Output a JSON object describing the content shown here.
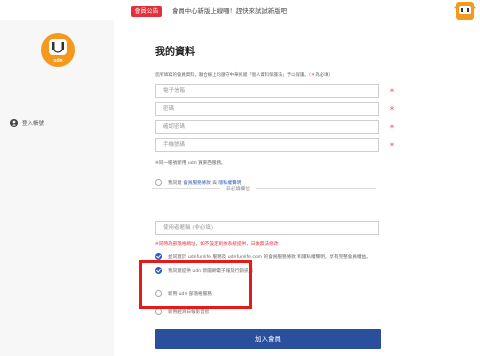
{
  "topbar": {
    "badge": "會員公告",
    "notice": "會員中心新版上線囉！趕快來試試新版吧",
    "colors": {
      "badge": "#e2313a"
    }
  },
  "sidebar": {
    "logo_icon": "udn-mascot-logo",
    "logo_text": "udn",
    "login_label": "登入帳號",
    "login_icon": "user-icon"
  },
  "main": {
    "title": "我的資料",
    "intro": "您所填寫的會員資料，聯合線上均遵守中華民國「個人資料保護法」予以保護。（",
    "intro_req": "＊",
    "intro_tail": "為必填）",
    "fields": [
      {
        "placeholder": "電子信箱"
      },
      {
        "placeholder": "密碼"
      },
      {
        "placeholder": "確認密碼"
      },
      {
        "placeholder": "手機號碼"
      }
    ],
    "required_mark": "＊",
    "service_hint": "※同一帳號新用 udn 買東西服務。",
    "agree_prefix": "我同意 ",
    "agree_terms": "會員服務條款",
    "agree_and": " 與 ",
    "agree_privacy": "隱私權聲明",
    "divider_label": "非必填欄位",
    "nickname_placeholder": "使用者暱稱 (非必填)",
    "nickname_note": "※同時為部落格網址，如不設定則依系統提供，日後無法修改",
    "consent_text": "並同意於 udnfunlife 服務及 udnfunlife.com 的會員服務條款 和隱私權聲明，享有完整會員權益。",
    "partial_text": "我同意提供 udn 新聞網電子報及行銷訊息",
    "option_1": "新用 udn 部落格服務",
    "option_2": "新用經濟日報影音智",
    "submit_label": "加入會員",
    "colors": {
      "primary": "#2a4f9c",
      "link": "#2e5cb8",
      "highlight": "#e31b1b"
    }
  }
}
